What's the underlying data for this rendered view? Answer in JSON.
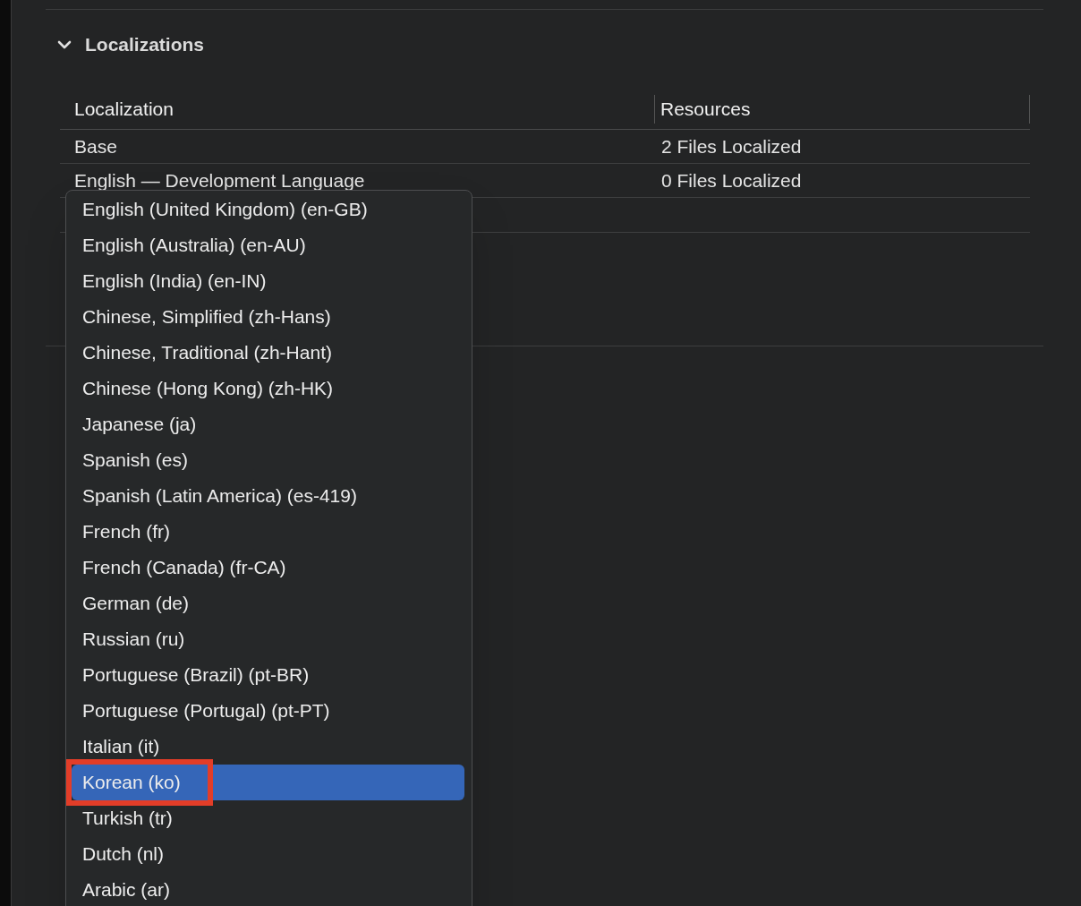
{
  "section": {
    "title": "Localizations",
    "expanded": true
  },
  "table": {
    "columns": [
      "Localization",
      "Resources"
    ],
    "rows": [
      {
        "cells": [
          "Base",
          "2 Files Localized"
        ]
      },
      {
        "cells": [
          "English — Development Language",
          "0 Files Localized"
        ]
      }
    ]
  },
  "menu": {
    "items": [
      {
        "label": "English (United Kingdom) (en-GB)",
        "selected": false,
        "outlined": false
      },
      {
        "label": "English (Australia) (en-AU)",
        "selected": false,
        "outlined": false
      },
      {
        "label": "English (India) (en-IN)",
        "selected": false,
        "outlined": false
      },
      {
        "label": "Chinese, Simplified (zh-Hans)",
        "selected": false,
        "outlined": false
      },
      {
        "label": "Chinese, Traditional (zh-Hant)",
        "selected": false,
        "outlined": false
      },
      {
        "label": "Chinese (Hong Kong) (zh-HK)",
        "selected": false,
        "outlined": false
      },
      {
        "label": "Japanese (ja)",
        "selected": false,
        "outlined": false
      },
      {
        "label": "Spanish (es)",
        "selected": false,
        "outlined": false
      },
      {
        "label": "Spanish (Latin America) (es-419)",
        "selected": false,
        "outlined": false
      },
      {
        "label": "French (fr)",
        "selected": false,
        "outlined": false
      },
      {
        "label": "French (Canada) (fr-CA)",
        "selected": false,
        "outlined": false
      },
      {
        "label": "German (de)",
        "selected": false,
        "outlined": false
      },
      {
        "label": "Russian (ru)",
        "selected": false,
        "outlined": false
      },
      {
        "label": "Portuguese (Brazil) (pt-BR)",
        "selected": false,
        "outlined": false
      },
      {
        "label": "Portuguese (Portugal) (pt-PT)",
        "selected": false,
        "outlined": false
      },
      {
        "label": "Italian (it)",
        "selected": false,
        "outlined": false
      },
      {
        "label": "Korean (ko)",
        "selected": true,
        "outlined": true
      },
      {
        "label": "Turkish (tr)",
        "selected": false,
        "outlined": false
      },
      {
        "label": "Dutch (nl)",
        "selected": false,
        "outlined": false
      },
      {
        "label": "Arabic (ar)",
        "selected": false,
        "outlined": false
      }
    ]
  }
}
